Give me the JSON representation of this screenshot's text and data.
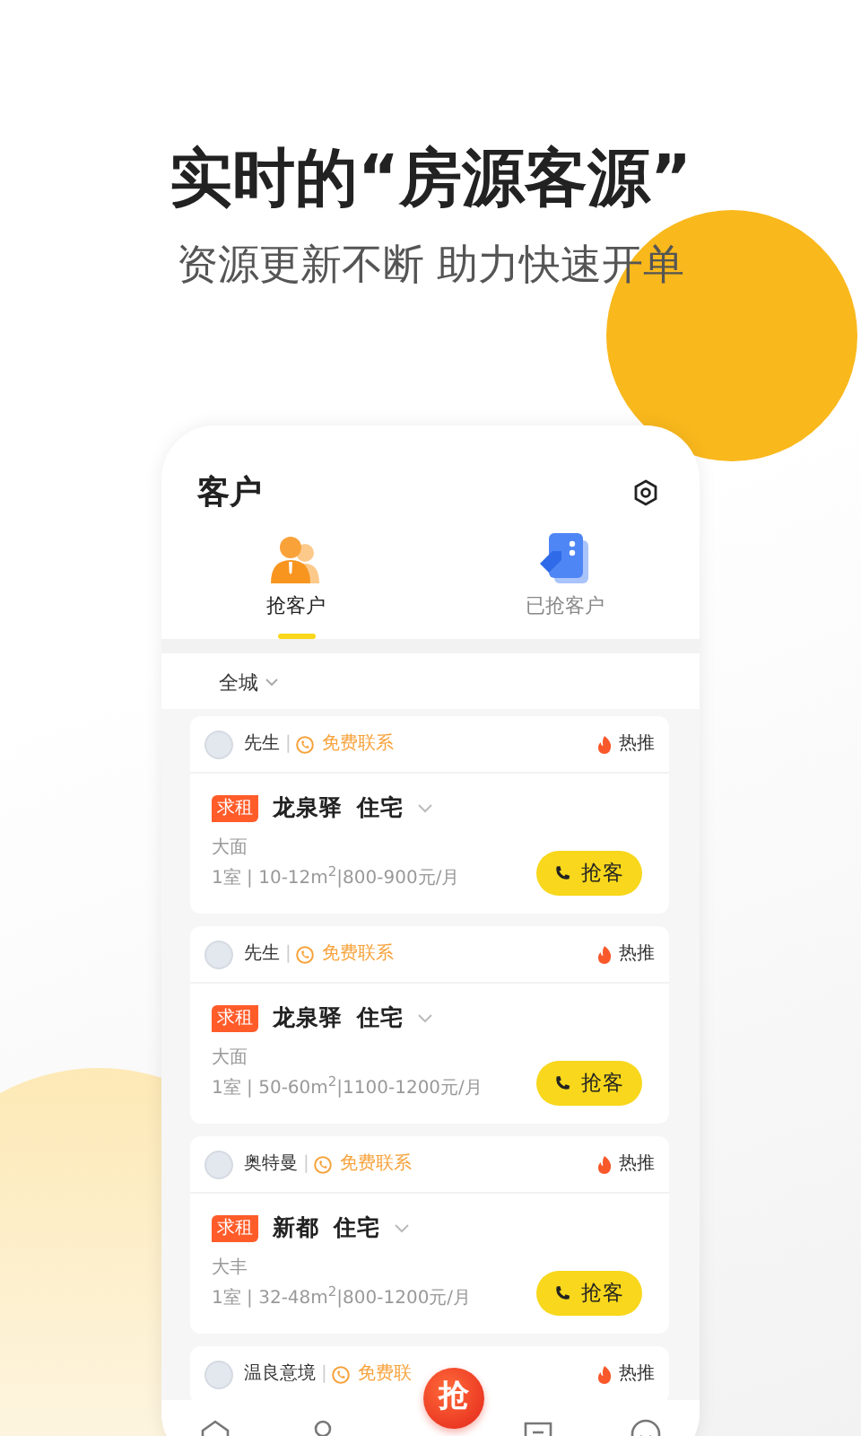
{
  "headline": "实时的“房源客源”",
  "subheadline": "资源更新不断 助力快速开单",
  "app": {
    "title": "客户",
    "tabs": [
      {
        "label": "抢客户",
        "selected": true,
        "kind": "grab"
      },
      {
        "label": "已抢客户",
        "selected": false,
        "kind": "grabbed"
      }
    ],
    "filter": "全城",
    "cards": [
      {
        "name": "先生",
        "separator": "|",
        "contact": "免费联系",
        "hot": "热推",
        "tag": "求租",
        "area": "龙泉驿",
        "type": "住宅",
        "district": "大面",
        "details": "1室 | 10-12m$^{2}$|800-900元/月",
        "action": "抢客"
      },
      {
        "name": "先生",
        "separator": "|",
        "contact": "免费联系",
        "hot": "热推",
        "tag": "求租",
        "area": "龙泉驿",
        "type": "住宅",
        "district": "大面",
        "details": "1室 | 50-60m$^{2}$|1100-1200元/月",
        "action": "抢客"
      },
      {
        "name": "奥特曼",
        "separator": "|",
        "contact": "免费联系",
        "hot": "热推",
        "tag": "求租",
        "area": "新都",
        "type": "住宅",
        "district": "大丰",
        "details": "1室 | 32-48m$^{2}$|800-1200元/月",
        "action": "抢客"
      },
      {
        "name": "温良意境",
        "separator": "|",
        "contact": "免费联",
        "hot": "热推"
      }
    ],
    "nav_center": "抢"
  }
}
